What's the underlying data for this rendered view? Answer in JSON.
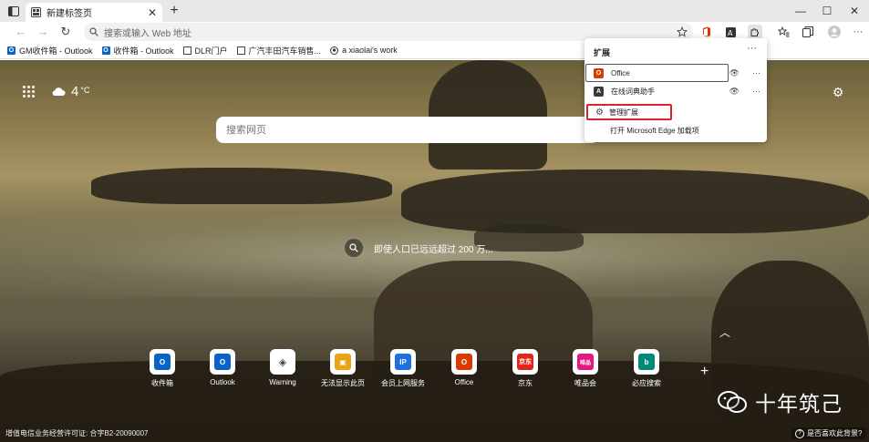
{
  "tab": {
    "title": "新建标签页",
    "close": "✕"
  },
  "window": {
    "minimize": "—",
    "maximize": "☐",
    "close": "✕"
  },
  "toolbar": {
    "back": "←",
    "forward": "→",
    "refresh": "↻",
    "address_placeholder": "搜索或输入 Web 地址"
  },
  "bookmarks": [
    {
      "label": "GM收件箱 - Outlook",
      "icon": "outlook-icon"
    },
    {
      "label": "收件箱 - Outlook",
      "icon": "outlook-icon"
    },
    {
      "label": "DLR门户",
      "icon": "page-icon"
    },
    {
      "label": "广汽丰田汽车销售...",
      "icon": "page-icon"
    },
    {
      "label": "a xiaolai's work",
      "icon": "github-icon"
    }
  ],
  "weather": {
    "temperature": "4",
    "unit": "°C"
  },
  "search": {
    "placeholder": "搜索网页"
  },
  "photo": {
    "caption": "即使人口已远远超过 200 万..."
  },
  "quicklinks": [
    {
      "label": "收件箱",
      "color": "#0a64c7",
      "mark": "O"
    },
    {
      "label": "Outlook",
      "color": "#0a64c7",
      "mark": "O"
    },
    {
      "label": "Warning",
      "color": "#555555",
      "mark": "◈"
    },
    {
      "label": "无法显示此页",
      "color": "#e8a412",
      "mark": "▣"
    },
    {
      "label": "会员上网服务",
      "color": "#1f6fe0",
      "mark": "IP"
    },
    {
      "label": "Office",
      "color": "#d83b01",
      "mark": "O"
    },
    {
      "label": "京东",
      "color": "#e1251b",
      "mark": "京东"
    },
    {
      "label": "唯品会",
      "color": "#e3187c",
      "mark": "唯品"
    },
    {
      "label": "必应搜索",
      "color": "#00897b",
      "mark": "b"
    }
  ],
  "footer": {
    "license": "增值电信业务经营许可证: 合字B2-20090007",
    "watermark": "十年筑己",
    "like_background": "是否喜欢此背景?"
  },
  "extensions_popup": {
    "title": "扩展",
    "more": "···",
    "items": [
      {
        "name": "Office",
        "color": "#d83b01"
      },
      {
        "name": "在线词典助手",
        "color": "#3a3a3a"
      }
    ],
    "manage": "管理扩展",
    "open_addons": "打开 Microsoft Edge 加载项"
  },
  "colors": {
    "highlight": "#d9232d",
    "accent": "#0a64c7"
  }
}
